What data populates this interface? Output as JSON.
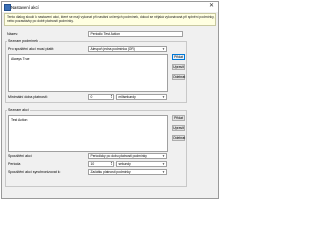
{
  "window": {
    "title": "Nastavení akcí",
    "close_glyph": "✕"
  },
  "info": {
    "text": "Tento dialog slouží k nastavení akcí, které se mají vykonat při nastání určených podmínek, dokud se nějaká vykonávaná při splnění podmínky, nebo pozastávky po době platnosti podmínky."
  },
  "name": {
    "label": "Název:",
    "value": "Periodic Test Action"
  },
  "conditions": {
    "title": "Seznam podmínek",
    "for_actions_label": "Pro spuštění akcí musí platit:",
    "for_actions_value": "Alespoň jedna podmínka (OR)",
    "items": [
      "Always True"
    ],
    "buttons": {
      "add": "Přidat",
      "edit": "Upravit",
      "remove": "Odebrat"
    },
    "min_duration_label": "Minimální doba platnosti:",
    "min_duration_value": "0",
    "min_duration_unit": "milisekundy"
  },
  "actions": {
    "title": "Seznam akcí",
    "items": [
      "Test Action"
    ],
    "buttons": {
      "add": "Přidat",
      "edit": "Upravit",
      "remove": "Odebrat"
    },
    "run_label": "Spouštění akcí",
    "run_value": "Periodicky po dobu platnosti podmínky",
    "period_label": "Perioda",
    "period_value": "10",
    "period_unit": "sekundy",
    "sync_label": "Spouštění akcí synchronizovat k:",
    "sync_value": "Začátku platnosti podmínky"
  }
}
